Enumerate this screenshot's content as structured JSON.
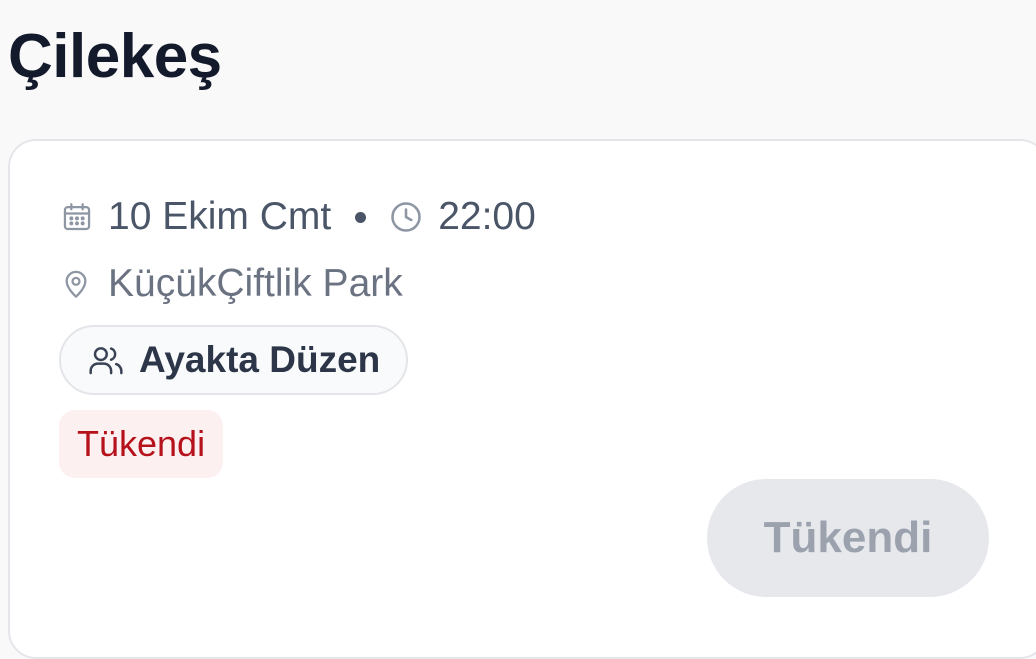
{
  "event": {
    "title": "Çilekeş",
    "date": "10 Ekim Cmt",
    "time": "22:00",
    "venue": "KüçükÇiftlik Park",
    "seating": "Ayakta Düzen",
    "status_badge": "Tükendi",
    "action_label": "Tükendi"
  },
  "icons": {
    "date": "calendar-icon",
    "time": "clock-icon",
    "venue": "map-pin-icon",
    "seating": "users-icon"
  },
  "colors": {
    "title": "#131a2b",
    "meta_text": "#4a5567",
    "venue_text": "#6b7383",
    "badge_text": "#b5121b",
    "badge_bg": "#fdf0f0",
    "button_bg": "#e7e8ec",
    "button_text": "#9ba2ae"
  }
}
